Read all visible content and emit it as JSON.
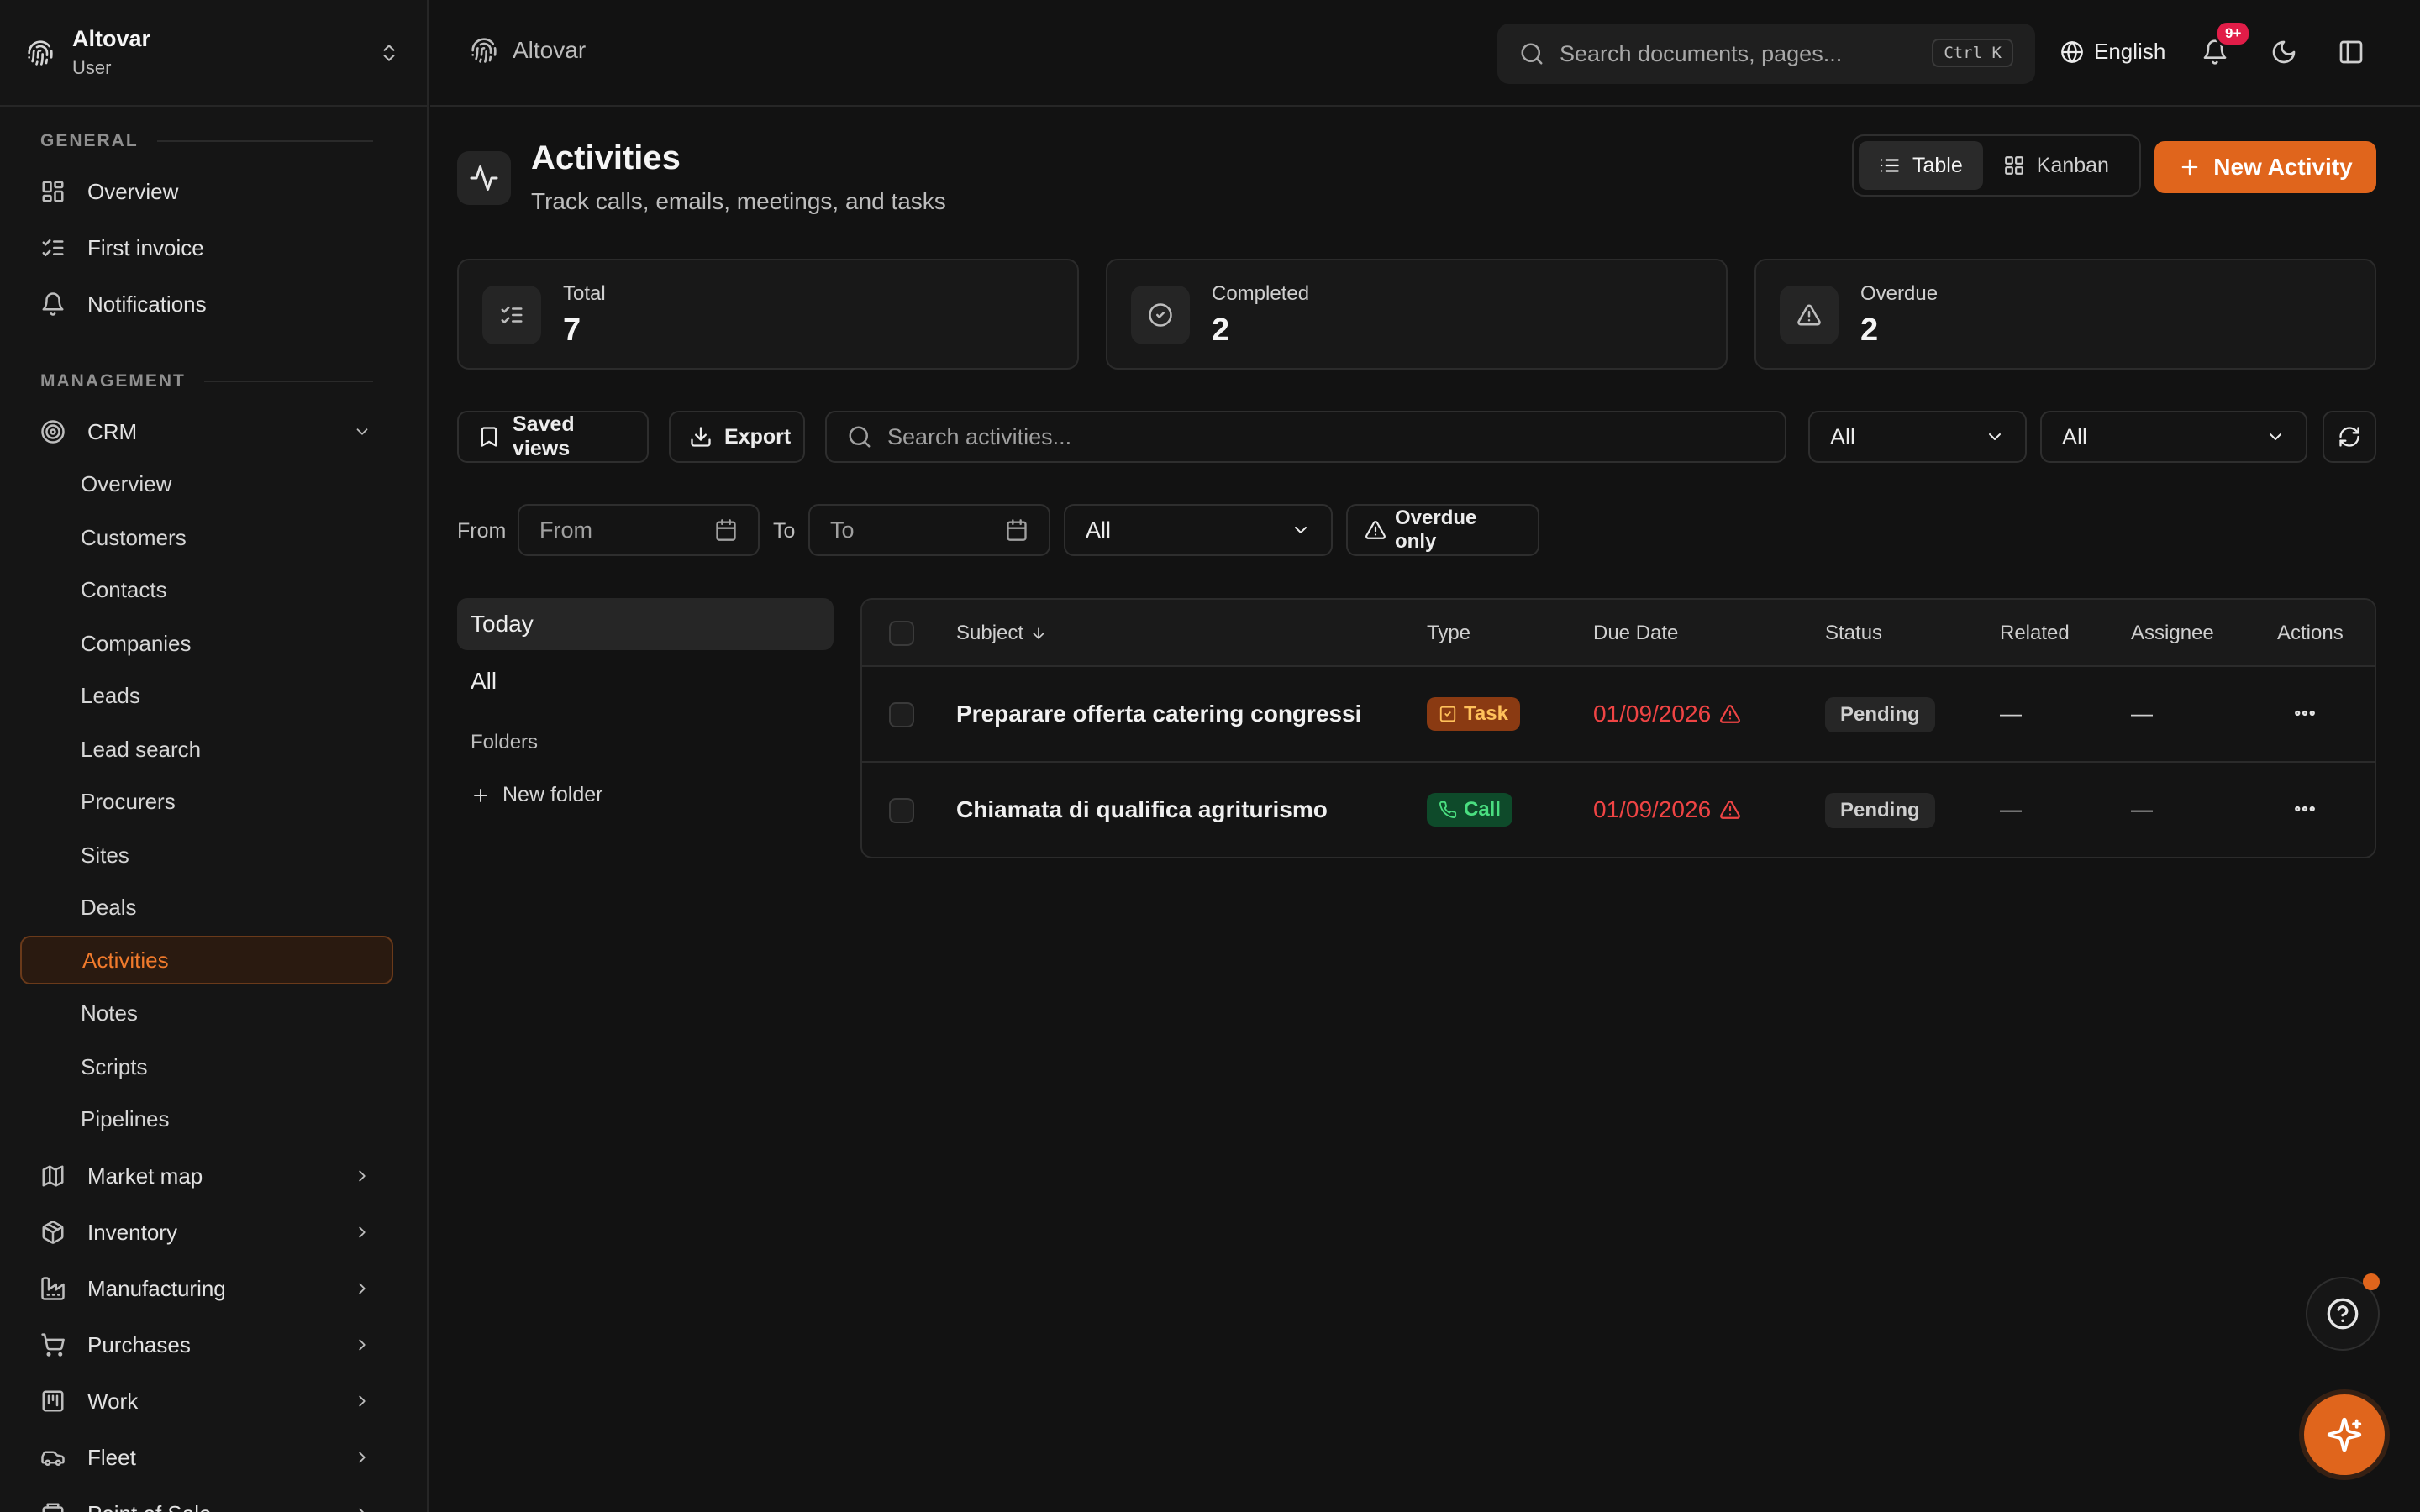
{
  "brand": {
    "name": "Altovar",
    "role": "User"
  },
  "colors": {
    "accent": "#e0651c",
    "danger": "#ef4444",
    "badge": "#e11d48",
    "call": "#4ade80",
    "task": "#ffc15a"
  },
  "sidebar": {
    "general_label": "GENERAL",
    "general": [
      {
        "label": "Overview",
        "icon": "dashboard-icon"
      },
      {
        "label": "First invoice",
        "icon": "checklist-icon"
      },
      {
        "label": "Notifications",
        "icon": "bell-icon"
      }
    ],
    "management_label": "MANAGEMENT",
    "crm_label": "CRM",
    "crm_items": [
      "Overview",
      "Customers",
      "Contacts",
      "Companies",
      "Leads",
      "Lead search",
      "Procurers",
      "Sites",
      "Deals",
      "Activities",
      "Notes",
      "Scripts",
      "Pipelines"
    ],
    "active_item": "Activities",
    "groups": [
      {
        "label": "Market map",
        "icon": "map-icon"
      },
      {
        "label": "Inventory",
        "icon": "package-icon"
      },
      {
        "label": "Manufacturing",
        "icon": "factory-icon"
      },
      {
        "label": "Purchases",
        "icon": "cart-icon"
      },
      {
        "label": "Work",
        "icon": "kanban-icon"
      },
      {
        "label": "Fleet",
        "icon": "car-icon"
      },
      {
        "label": "Point of Sale",
        "icon": "register-icon"
      }
    ]
  },
  "topbar": {
    "breadcrumb": "Altovar",
    "search_placeholder": "Search documents, pages...",
    "shortcut": "Ctrl K",
    "language": "English",
    "notifications_badge": "9+"
  },
  "page": {
    "title": "Activities",
    "subtitle": "Track calls, emails, meetings, and tasks",
    "view_table": "Table",
    "view_kanban": "Kanban",
    "new_button": "New Activity"
  },
  "stats": [
    {
      "label": "Total",
      "value": "7",
      "icon": "list-check-icon"
    },
    {
      "label": "Completed",
      "value": "2",
      "icon": "check-circle-icon"
    },
    {
      "label": "Overdue",
      "value": "2",
      "icon": "warning-icon"
    }
  ],
  "filters": {
    "saved_views": "Saved views",
    "export": "Export",
    "search_placeholder": "Search activities...",
    "select_1": "All",
    "select_2": "All",
    "from_label": "From",
    "from_placeholder": "From",
    "to_label": "To",
    "to_placeholder": "To",
    "select_3": "All",
    "overdue_only": "Overdue only"
  },
  "folders": {
    "today": "Today",
    "all": "All",
    "folders_label": "Folders",
    "new_folder": "New folder"
  },
  "table": {
    "columns": {
      "subject": "Subject",
      "type": "Type",
      "due_date": "Due Date",
      "status": "Status",
      "related": "Related",
      "assignee": "Assignee",
      "actions": "Actions"
    },
    "rows": [
      {
        "subject": "Preparare offerta catering congressi",
        "type": "Task",
        "due": "01/09/2026",
        "status": "Pending",
        "related": "—",
        "assignee": "—"
      },
      {
        "subject": "Chiamata di qualifica agriturismo",
        "type": "Call",
        "due": "01/09/2026",
        "status": "Pending",
        "related": "—",
        "assignee": "—"
      }
    ]
  }
}
